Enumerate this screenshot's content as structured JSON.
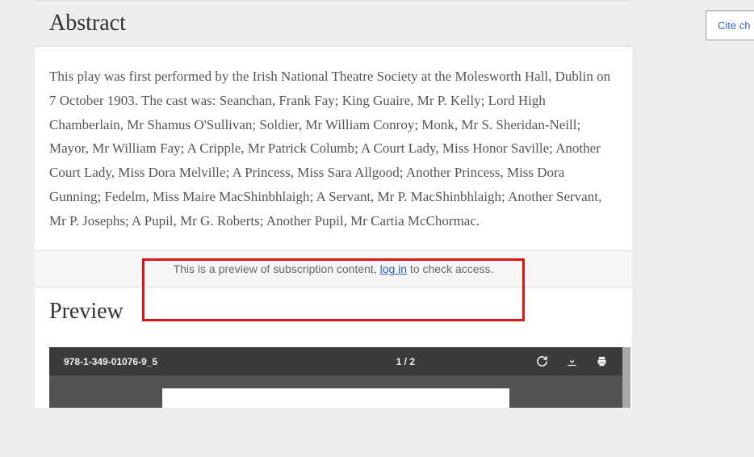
{
  "abstract": {
    "heading": "Abstract",
    "body": "This play was first performed by the Irish National Theatre Society at the Molesworth Hall, Dublin on 7 October 1903. The cast was: Seanchan, Frank Fay; King Guaire, Mr P. Kelly; Lord High Chamberlain, Mr Shamus O'Sullivan; Soldier, Mr William Conroy; Monk, Mr S. Sheridan-Neill; Mayor, Mr William Fay; A Cripple, Mr Patrick Columb; A Court Lady, Miss Honor Saville; Another Court Lady, Miss Dora Melville; A Princess, Miss Sara Allgood; Another Princess, Miss Dora Gunning; Fedelm, Miss Maire MacShinbhlaigh; A Servant, Mr P. MacShinbhlaigh; Another Servant, Mr P. Josephs; A Pupil, Mr G. Roberts; Another Pupil, Mr Cartia McChormac."
  },
  "paywall": {
    "prefix": "This is a preview of subscription content, ",
    "login_text": "log in",
    "suffix": " to check access."
  },
  "preview": {
    "heading": "Preview",
    "pdf": {
      "filename": "978-1-349-01076-9_5",
      "pages": "1 / 2"
    }
  },
  "sidebar": {
    "cite_label": "Cite ch"
  }
}
